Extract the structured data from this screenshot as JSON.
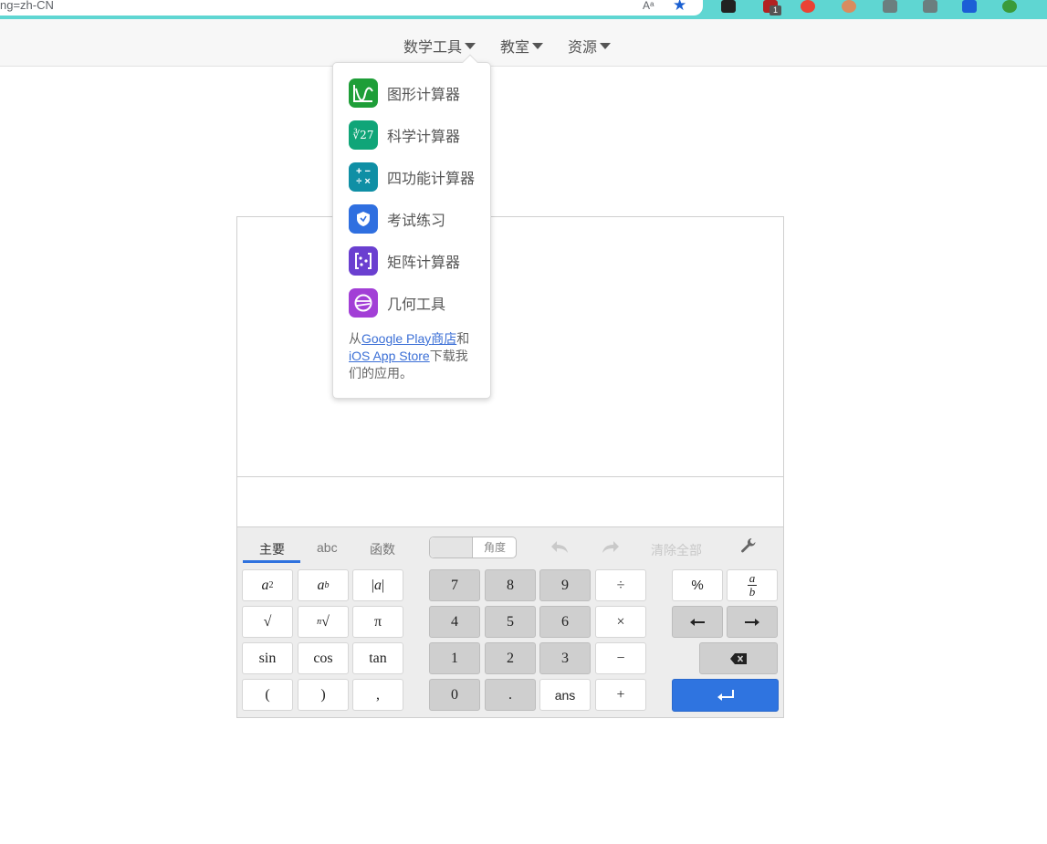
{
  "browser": {
    "url_fragment": "ng=zh-CN",
    "read_aloud_label": "Aᵃ"
  },
  "nav": {
    "items": [
      {
        "label": "数学工具"
      },
      {
        "label": "教室"
      },
      {
        "label": "资源"
      }
    ]
  },
  "menu": {
    "items": [
      {
        "label": "图形计算器",
        "icon": "graphing-calculator-icon",
        "color": "#1e9e38"
      },
      {
        "label": "科学计算器",
        "icon": "scientific-calculator-icon",
        "color": "#10a578"
      },
      {
        "label": "四功能计算器",
        "icon": "four-function-calculator-icon",
        "color": "#0f8fa5"
      },
      {
        "label": "考试练习",
        "icon": "test-practice-icon",
        "color": "#2f6fe0"
      },
      {
        "label": "矩阵计算器",
        "icon": "matrix-calculator-icon",
        "color": "#6a3fd0"
      },
      {
        "label": "几何工具",
        "icon": "geometry-tool-icon",
        "color": "#a23fd6"
      }
    ],
    "footer": {
      "prefix": "从",
      "google_play": "Google Play",
      "store": "商店",
      "and": "和",
      "ios_store": "iOS App Store",
      "suffix": "下载我们的应用。"
    }
  },
  "keypad": {
    "tabs": [
      "主要",
      "abc",
      "函数"
    ],
    "angle_mode": "角度",
    "clear_all": "清除全部",
    "accent_color": "#2f74e0",
    "left_keys": [
      [
        "a²",
        "aᵇ",
        "|a|"
      ],
      [
        "√",
        "ⁿ√",
        "π"
      ],
      [
        "sin",
        "cos",
        "tan"
      ],
      [
        "(",
        ")",
        ","
      ]
    ],
    "num_keys": [
      [
        "7",
        "8",
        "9",
        "÷"
      ],
      [
        "4",
        "5",
        "6",
        "×"
      ],
      [
        "1",
        "2",
        "3",
        "−"
      ],
      [
        "0",
        ".",
        "ans",
        "+"
      ]
    ],
    "right_keys": {
      "percent": "%",
      "fraction_num": "a",
      "fraction_den": "b"
    }
  }
}
